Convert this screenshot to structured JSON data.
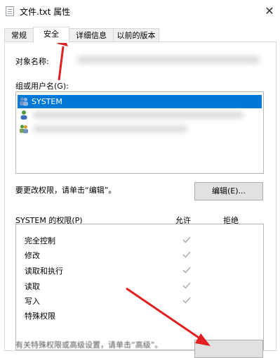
{
  "window": {
    "title": "文件.txt 属性",
    "close": "✕"
  },
  "tabs": [
    {
      "label": "常规",
      "active": false
    },
    {
      "label": "安全",
      "active": true
    },
    {
      "label": "详细信息",
      "active": false
    },
    {
      "label": "以前的版本",
      "active": false
    }
  ],
  "security": {
    "object_name_label": "对象名称:",
    "group_label": "组或用户名(G):",
    "users": [
      {
        "name": "SYSTEM",
        "selected": true,
        "icon": "users-group-icon"
      },
      {
        "name": "",
        "selected": false,
        "icon": "user-icon"
      },
      {
        "name": "",
        "selected": false,
        "icon": "users-group-icon"
      }
    ],
    "change_hint": "要更改权限，请单击“编辑”。",
    "edit_button": "编辑(E)...",
    "perm_title": "SYSTEM 的权限(P)",
    "allow_header": "允许",
    "deny_header": "拒绝",
    "permissions": [
      {
        "name": "完全控制",
        "allow": true
      },
      {
        "name": "修改",
        "allow": true
      },
      {
        "name": "读取和执行",
        "allow": true
      },
      {
        "name": "读取",
        "allow": true
      },
      {
        "name": "写入",
        "allow": true
      },
      {
        "name": "特殊权限",
        "allow": false
      }
    ],
    "bottom_hint": "有关特殊权限或高级设置，请单击“高级”。"
  },
  "colors": {
    "selection": "#0078d7",
    "arrow": "#e02020",
    "check": "#b0b0b0"
  }
}
